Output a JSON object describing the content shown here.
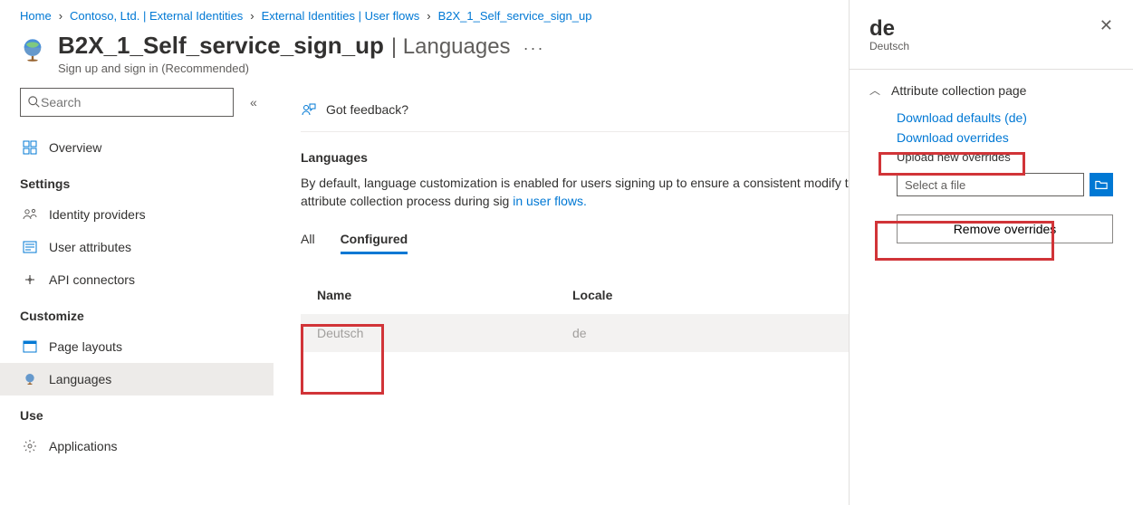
{
  "breadcrumb": [
    "Home",
    "Contoso, Ltd. | External Identities",
    "External Identities | User flows",
    "B2X_1_Self_service_sign_up"
  ],
  "header": {
    "title": "B2X_1_Self_service_sign_up",
    "subtitle_suffix": "| Languages",
    "subhead": "Sign up and sign in (Recommended)"
  },
  "search_placeholder": "Search",
  "navgroups": {
    "overview": "Overview",
    "settings_h": "Settings",
    "identity": "Identity providers",
    "user_attr": "User attributes",
    "api_conn": "API connectors",
    "customize_h": "Customize",
    "page_layouts": "Page layouts",
    "languages": "Languages",
    "use_h": "Use",
    "applications": "Applications"
  },
  "feedback": "Got feedback?",
  "section_heading": "Languages",
  "description_pre": "By default, language customization is enabled for users signing up to ensure a consistent modify the strings displayed to users as part of the attribute collection process during sig",
  "description_link": "in user flows.",
  "tabs": {
    "all": "All",
    "configured": "Configured"
  },
  "table": {
    "cols": {
      "name": "Name",
      "locale": "Locale"
    },
    "row": {
      "name": "Deutsch",
      "locale": "de"
    }
  },
  "panel": {
    "title": "de",
    "subtitle": "Deutsch",
    "accordion": "Attribute collection page",
    "download_defaults": "Download defaults (de)",
    "download_overrides": "Download overrides",
    "upload_label": "Upload new overrides",
    "file_placeholder": "Select a file",
    "remove": "Remove overrides"
  }
}
